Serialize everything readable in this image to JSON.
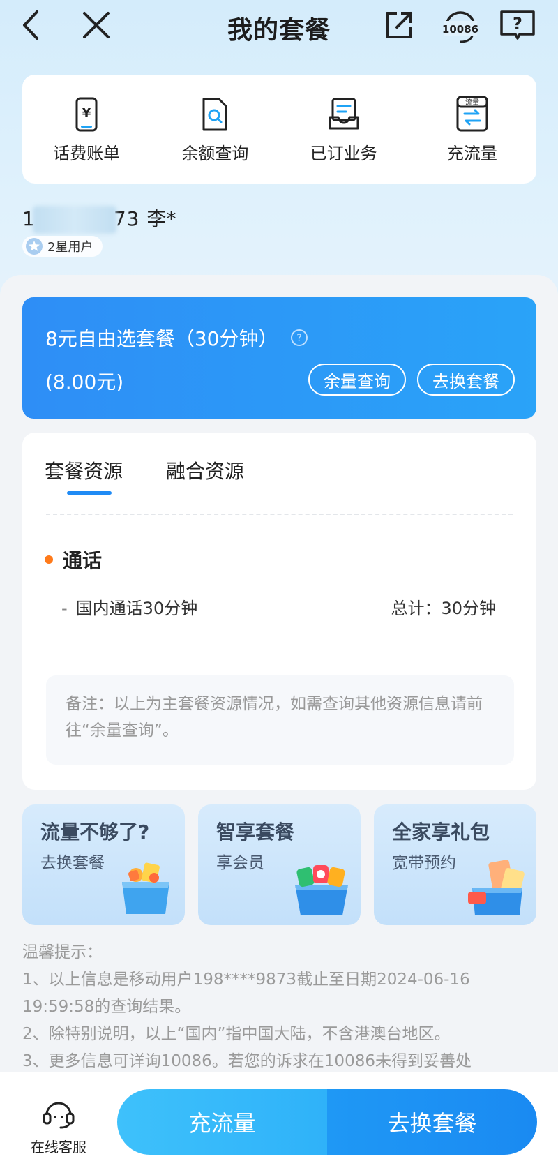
{
  "nav": {
    "title": "我的套餐",
    "hotline": "10086"
  },
  "quick_actions": [
    {
      "label": "话费账单",
      "icon": "bill-phone-icon"
    },
    {
      "label": "余额查询",
      "icon": "balance-search-icon"
    },
    {
      "label": "已订业务",
      "icon": "subscribed-tray-icon"
    },
    {
      "label": "充流量",
      "icon": "data-recharge-icon",
      "icon_text": "流量"
    }
  ],
  "user": {
    "number_prefix": "1",
    "number_suffix": "73",
    "name": "李*",
    "level": "2星用户"
  },
  "plan": {
    "name": "8元自由选套餐（30分钟）",
    "price": "(8.00元)",
    "btn_balance": "余量查询",
    "btn_change": "去换套餐"
  },
  "resources": {
    "tabs": [
      "套餐资源",
      "融合资源"
    ],
    "active_tab": 0,
    "section_title": "通话",
    "item_name": "国内通话30分钟",
    "item_dash": "-",
    "item_total": "总计：30分钟",
    "note": "备注：以上为主套餐资源情况，如需查询其他资源信息请前往“余量查询”。"
  },
  "promos": [
    {
      "title": "流量不够了?",
      "subtitle": "去换套餐"
    },
    {
      "title": "智享套餐",
      "subtitle": "享会员"
    },
    {
      "title": "全家享礼包",
      "subtitle": "宽带预约"
    }
  ],
  "tips": {
    "title": "温馨提示：",
    "line1": "1、以上信息是移动用户198****9873截止至日期2024-06-16 19:59:58的查询结果。",
    "line2": "2、除特别说明，以上“国内”指中国大陆，不含港澳台地区。",
    "line3": "3、更多信息可详询10086。若您的诉求在10086未得到妥善处"
  },
  "bottom": {
    "service_label": "在线客服",
    "btn_recharge": "充流量",
    "btn_change": "去换套餐"
  },
  "colors": {
    "accent": "#1f8bf5",
    "plan_card": "#2e8ef6",
    "dot": "#ff7a1a"
  }
}
